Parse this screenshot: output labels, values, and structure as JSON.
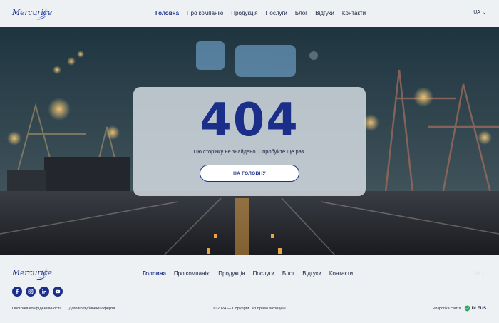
{
  "header": {
    "logo_text": "Mercurice",
    "nav": [
      {
        "label": "Головна",
        "active": true
      },
      {
        "label": "Про компанію",
        "active": false
      },
      {
        "label": "Продукція",
        "active": false
      },
      {
        "label": "Послуги",
        "active": false
      },
      {
        "label": "Блог",
        "active": false
      },
      {
        "label": "Відгуки",
        "active": false
      },
      {
        "label": "Контакти",
        "active": false
      }
    ],
    "language": "UA"
  },
  "error": {
    "code": "404",
    "message": "Цю сторінку не знайдено. Спробуйте ще раз.",
    "button_label": "НА ГОЛОВНУ"
  },
  "footer": {
    "logo_text": "Mercurice",
    "nav": [
      {
        "label": "Головна",
        "active": true
      },
      {
        "label": "Про компанію",
        "active": false
      },
      {
        "label": "Продукція",
        "active": false
      },
      {
        "label": "Послуги",
        "active": false
      },
      {
        "label": "Блог",
        "active": false
      },
      {
        "label": "Відгуки",
        "active": false
      },
      {
        "label": "Контакти",
        "active": false
      }
    ],
    "language": "UA",
    "socials": [
      "facebook-icon",
      "instagram-icon",
      "linkedin-icon",
      "youtube-icon"
    ],
    "legal": [
      "Політика конфіденційності",
      "Договір публічної оферти"
    ],
    "copyright": "© 2024 — Copyright. Усі права захищені",
    "developer_label": "Розробка сайта",
    "developer_brand": "DLEUS"
  },
  "colors": {
    "accent": "#1b2f8a",
    "background": "#eef1f3",
    "text": "#1c2340"
  }
}
